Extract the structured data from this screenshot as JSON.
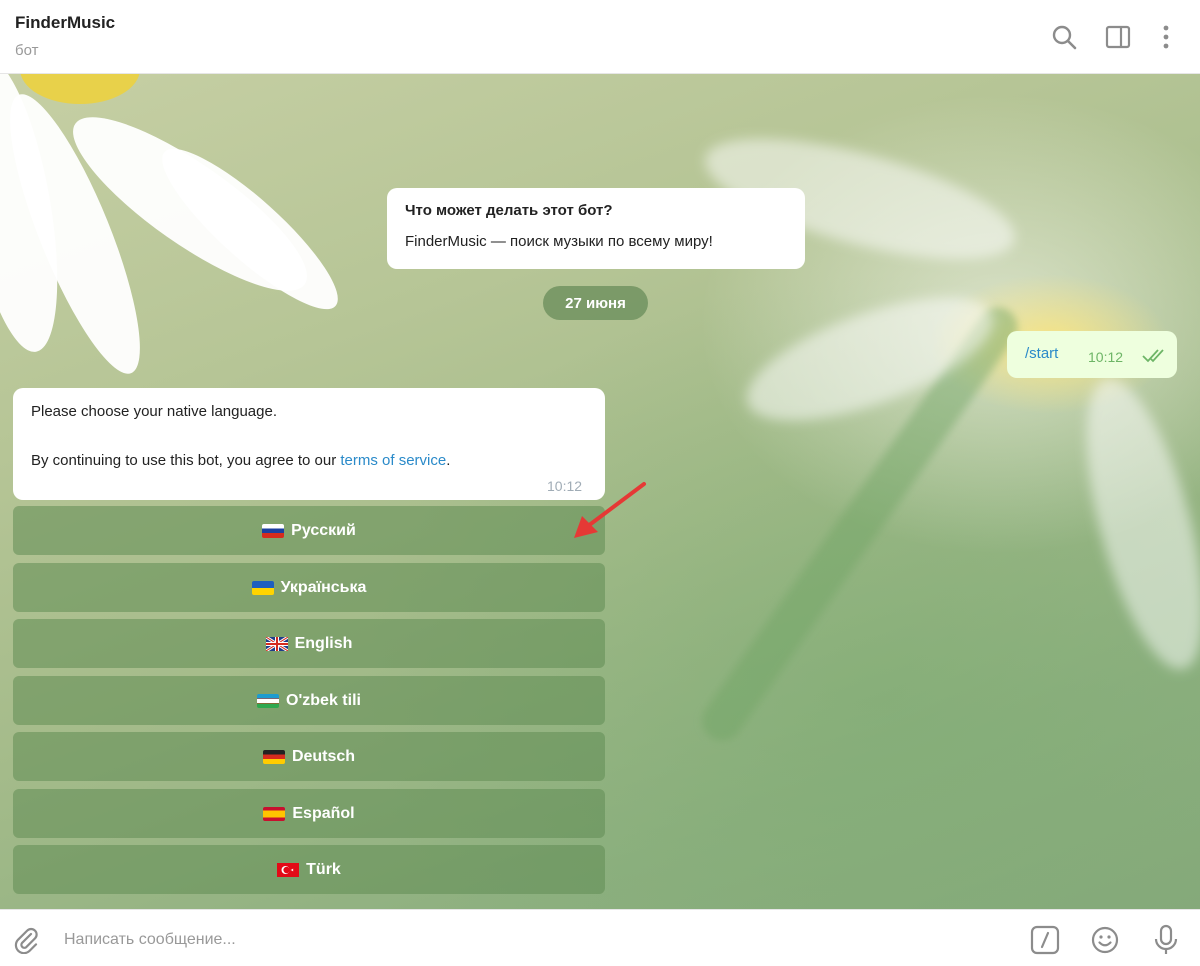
{
  "header": {
    "title": "FinderMusic",
    "subtitle": "бот"
  },
  "icons": {
    "search": "search-icon",
    "sidebar": "sidebar-toggle-icon",
    "more": "more-vertical-icon",
    "attach": "paperclip-icon",
    "commands": "slash-command-icon",
    "emoji": "emoji-icon",
    "mic": "microphone-icon"
  },
  "bot_info": {
    "question": "Что может делать этот бот?",
    "answer": "FinderMusic — поиск музыки по всему миру!"
  },
  "date_separator": "27 июня",
  "outgoing": {
    "text": "/start",
    "time": "10:12",
    "status": "read"
  },
  "incoming": {
    "line1": "Please choose your native language.",
    "line2_prefix": "By continuing to use this bot, you agree to our ",
    "link": "terms of service",
    "line2_suffix": ".",
    "time": "10:12"
  },
  "keyboard": [
    {
      "label": "Русский",
      "flag": "russia"
    },
    {
      "label": "Українська",
      "flag": "ukraine"
    },
    {
      "label": "English",
      "flag": "united-kingdom"
    },
    {
      "label": "O'zbek tili",
      "flag": "uzbekistan"
    },
    {
      "label": "Deutsch",
      "flag": "germany"
    },
    {
      "label": "Español",
      "flag": "spain"
    },
    {
      "label": "Türk",
      "flag": "turkey"
    }
  ],
  "composer": {
    "placeholder": "Написать сообщение..."
  },
  "colors": {
    "accent": "#2a8ac9",
    "outgoing_bubble": "#eeffde",
    "button_bg": "#6a9658",
    "annotation_arrow": "#e53935"
  }
}
